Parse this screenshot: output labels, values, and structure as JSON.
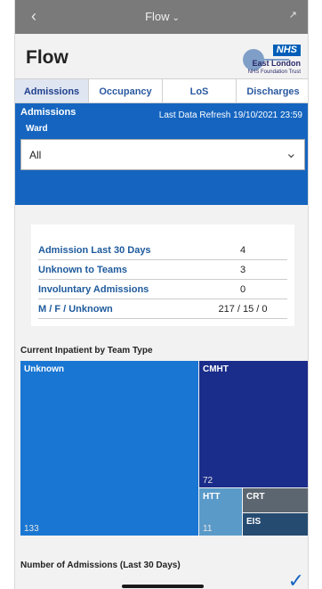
{
  "topbar": {
    "back_icon": "chevron-left-icon",
    "title": "Flow",
    "title_chevron": "chevron-down-icon",
    "minimize_icon": "minimize-icon"
  },
  "header": {
    "app_name": "Flow",
    "nhs_logo": "NHS",
    "org_name": "East London",
    "trust_name": "NHS Foundation Trust"
  },
  "tabs": [
    {
      "label": "Admissions",
      "active": true
    },
    {
      "label": "Occupancy",
      "active": false
    },
    {
      "label": "LoS",
      "active": false
    },
    {
      "label": "Discharges",
      "active": false
    }
  ],
  "admissions_panel": {
    "section_label": "Admissions",
    "refresh_text": "Last Data Refresh 19/10/2021 23:59",
    "ward_label": "Ward",
    "ward_value": "All"
  },
  "stats": [
    {
      "label": "Admission Last 30 Days",
      "value": "4"
    },
    {
      "label": "Unknown to Teams",
      "value": "3"
    },
    {
      "label": "Involuntary Admissions",
      "value": "0"
    },
    {
      "label": "M / F / Unknown",
      "value": "217 / 15 / 0"
    }
  ],
  "inpatient_section": {
    "title": "Current Inpatient by Team Type",
    "tiles": [
      {
        "name": "Unknown",
        "value": "133",
        "color": "#1976d2"
      },
      {
        "name": "CMHT",
        "value": "72",
        "color": "#1a2d8a"
      },
      {
        "name": "HTT",
        "value": "11",
        "color": "#5a9ac9"
      },
      {
        "name": "CRT",
        "value": "",
        "color": "#5b6670"
      },
      {
        "name": "EIS",
        "value": "",
        "color": "#254b70"
      }
    ]
  },
  "admissions_chart": {
    "title": "Number of Admissions (Last 30 Days)"
  },
  "colors": {
    "accent": "#1565c0",
    "tab_text": "#2a5aa0",
    "stat_label": "#1e5a9c"
  }
}
